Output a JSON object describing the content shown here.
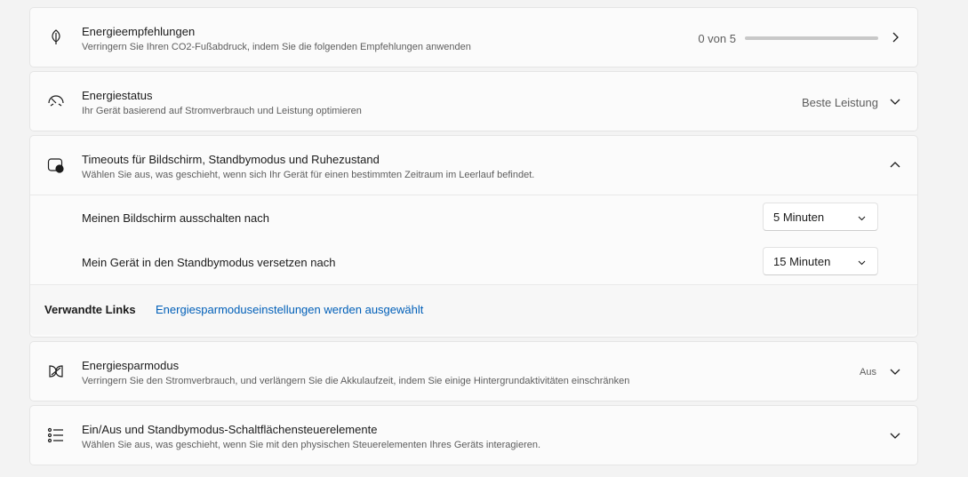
{
  "energy_recommendations": {
    "icon": "leaf-icon",
    "title": "Energieempfehlungen",
    "description": "Verringern Sie Ihren CO2-Fußabdruck, indem Sie die folgenden Empfehlungen anwenden",
    "progress_text": "0 von 5",
    "progress_value": 0,
    "progress_total": 5
  },
  "power_mode": {
    "icon": "gauge-icon",
    "title": "Energiestatus",
    "description": "Ihr Gerät basierend auf Stromverbrauch und Leistung optimieren",
    "value": "Beste Leistung"
  },
  "timeouts": {
    "icon": "screen-sleep-icon",
    "title": "Timeouts für Bildschirm, Standbymodus und Ruhezustand",
    "description": "Wählen Sie aus, was geschieht, wenn sich Ihr Gerät für einen bestimmten Zeitraum im Leerlauf befindet.",
    "screen_off_label": "Meinen Bildschirm ausschalten nach",
    "screen_off_value": "5 Minuten",
    "standby_label": "Mein Gerät in den Standbymodus versetzen nach",
    "standby_value": "15 Minuten",
    "related_links_label": "Verwandte Links",
    "related_link": "Energiesparmoduseinstellungen werden ausgewählt"
  },
  "energy_saver": {
    "icon": "leaf-shield-icon",
    "title": "Energiesparmodus",
    "description": "Verringern Sie den Stromverbrauch, und verlängern Sie die Akkulaufzeit, indem Sie einige Hintergrundaktivitäten einschränken",
    "value": "Aus"
  },
  "power_buttons": {
    "icon": "list-icon",
    "title": "Ein/Aus und Standbymodus-Schaltflächensteuerelemente",
    "description": "Wählen Sie aus, was geschieht, wenn Sie mit den physischen Steuerelementen Ihres Geräts interagieren."
  },
  "colors": {
    "accent": "#005fb8",
    "card_bg": "#fbfbfb",
    "page_bg": "#f3f3f3"
  }
}
